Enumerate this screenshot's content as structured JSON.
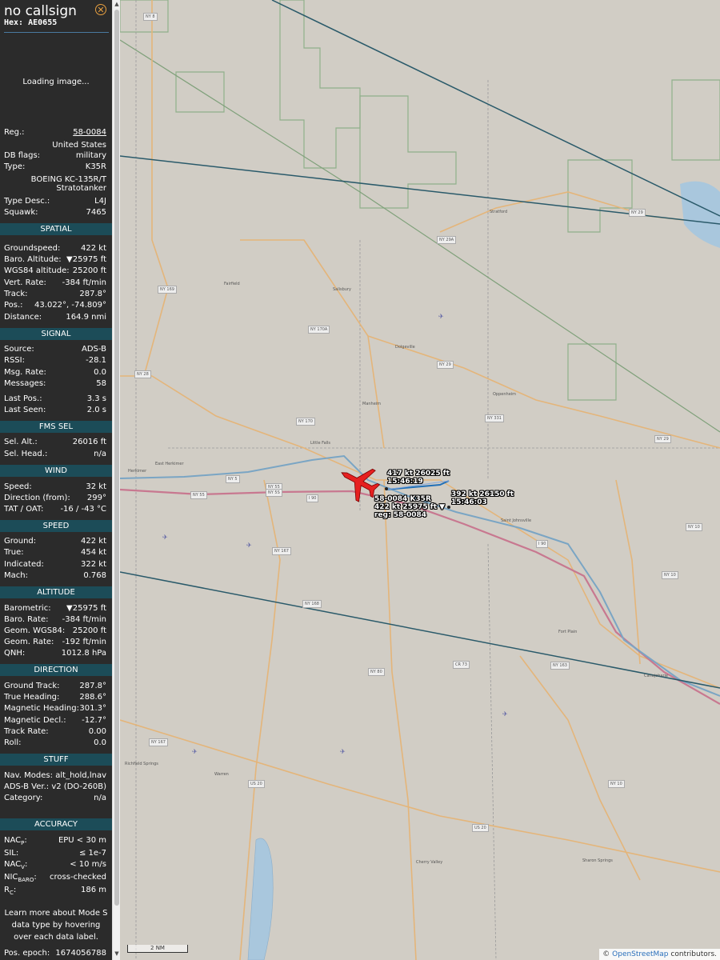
{
  "header": {
    "callsign": "no callsign",
    "hex_label": "Hex:",
    "hex": "AE0655",
    "close_icon": "close-icon",
    "loading_text": "Loading image..."
  },
  "info": {
    "reg_label": "Reg.:",
    "reg": "58-0084",
    "country": "United States",
    "db_flags_label": "DB flags:",
    "db_flags": "military",
    "type_label": "Type:",
    "type": "K35R",
    "type_name_1": "BOEING KC-135R/T",
    "type_name_2": "Stratotanker",
    "type_desc_label": "Type Desc.:",
    "type_desc": "L4J",
    "squawk_label": "Squawk:",
    "squawk": "7465"
  },
  "spatial": {
    "title": "SPATIAL",
    "rows": [
      {
        "k": "Groundspeed:",
        "v": "422 kt"
      },
      {
        "k": "Baro. Altitude:",
        "v": "▼25975 ft"
      },
      {
        "k": "WGS84 altitude:",
        "v": "25200 ft"
      },
      {
        "k": "Vert. Rate:",
        "v": "-384 ft/min"
      },
      {
        "k": "Track:",
        "v": "287.8°"
      },
      {
        "k": "Pos.:",
        "v": "43.022°, -74.809°"
      },
      {
        "k": "Distance:",
        "v": "164.9 nmi"
      }
    ]
  },
  "signal": {
    "title": "SIGNAL",
    "rows": [
      {
        "k": "Source:",
        "v": "ADS-B"
      },
      {
        "k": "RSSI:",
        "v": "-28.1"
      },
      {
        "k": "Msg. Rate:",
        "v": "0.0"
      },
      {
        "k": "Messages:",
        "v": "58"
      }
    ],
    "rows2": [
      {
        "k": "Last Pos.:",
        "v": "3.3 s"
      },
      {
        "k": "Last Seen:",
        "v": "2.0 s"
      }
    ]
  },
  "fms": {
    "title": "FMS SEL",
    "rows": [
      {
        "k": "Sel. Alt.:",
        "v": "26016 ft"
      },
      {
        "k": "Sel. Head.:",
        "v": "n/a"
      }
    ]
  },
  "wind": {
    "title": "WIND",
    "rows": [
      {
        "k": "Speed:",
        "v": "32 kt"
      },
      {
        "k": "Direction (from):",
        "v": "299°"
      },
      {
        "k": "TAT / OAT:",
        "v": "-16 / -43 °C"
      }
    ]
  },
  "speed": {
    "title": "SPEED",
    "rows": [
      {
        "k": "Ground:",
        "v": "422 kt"
      },
      {
        "k": "True:",
        "v": "454 kt"
      },
      {
        "k": "Indicated:",
        "v": "322 kt"
      },
      {
        "k": "Mach:",
        "v": "0.768"
      }
    ]
  },
  "altitude": {
    "title": "ALTITUDE",
    "rows": [
      {
        "k": "Barometric:",
        "v": "▼25975 ft"
      },
      {
        "k": "Baro. Rate:",
        "v": "-384 ft/min"
      },
      {
        "k": "Geom. WGS84:",
        "v": "25200 ft"
      },
      {
        "k": "Geom. Rate:",
        "v": "-192 ft/min"
      },
      {
        "k": "QNH:",
        "v": "1012.8 hPa"
      }
    ]
  },
  "direction": {
    "title": "DIRECTION",
    "rows": [
      {
        "k": "Ground Track:",
        "v": "287.8°"
      },
      {
        "k": "True Heading:",
        "v": "288.6°"
      },
      {
        "k": "Magnetic Heading:",
        "v": "301.3°"
      },
      {
        "k": "Magnetic Decl.:",
        "v": "-12.7°"
      },
      {
        "k": "Track Rate:",
        "v": "0.00"
      },
      {
        "k": "Roll:",
        "v": "0.0"
      }
    ]
  },
  "stuff": {
    "title": "STUFF",
    "rows": [
      {
        "k": "Nav. Modes:",
        "v": "alt_hold,lnav"
      },
      {
        "k": "ADS-B Ver.:",
        "v": "v2 (DO-260B)"
      },
      {
        "k": "Category:",
        "v": "n/a"
      }
    ]
  },
  "accuracy": {
    "title": "ACCURACY",
    "nacp_k": "NAC",
    "nacp_sub": "P",
    "nacp_v": "EPU < 30 m",
    "sil_k": "SIL:",
    "sil_v": "≤ 1e-7",
    "nacv_k": "NAC",
    "nacv_sub": "V",
    "nacv_v": "< 10 m/s",
    "nicbaro_k": "NIC",
    "nicbaro_sub": "BARO",
    "nicbaro_v": "cross-checked",
    "rc_k": "R",
    "rc_sub": "C",
    "rc_v": "186 m"
  },
  "footer": {
    "learn_more": "Learn more about Mode S data type by hovering over each data label.",
    "pos_epoch_label": "Pos. epoch:",
    "pos_epoch": "1674056788"
  },
  "map": {
    "scale": "2 NM",
    "attribution_prefix": "©",
    "attribution_link": "OpenStreetMap",
    "attribution_suffix": "contributors.",
    "aircraft_label_1": "58-0084 K35R",
    "aircraft_label_2": "422 kt 25975 ft ▼",
    "aircraft_label_3": "reg: 58-0084",
    "track_label_a_1": "417 kt  26025 ft",
    "track_label_a_2": "15:46:19",
    "track_label_b_1": "392 kt  26150 ft",
    "track_label_b_2": "15:46:03",
    "aircraft_icon": "airplane-icon",
    "places": {
      "herkimer": "Herkimer",
      "east_herkimer": "East Herkimer",
      "little_falls": "Little Falls",
      "fairfield": "Fairfield",
      "salisbury": "Salisbury",
      "dolgeville": "Dolgeville",
      "manheim": "Manheim",
      "oppenheim": "Oppenheim",
      "stratford": "Stratford",
      "st_johnsville": "Saint Johnsville",
      "fort_plain": "Fort Plain",
      "canajoharie": "Canajoharie",
      "cherry_valley": "Cherry Valley",
      "sharon_springs": "Sharon Springs",
      "richfield_springs": "Richfield Springs",
      "warren": "Warren"
    },
    "roads": {
      "ny8": "NY 8",
      "ny29": "NY 29",
      "ny29a": "NY 29A",
      "ny169": "NY 169",
      "ny170a": "NY 170A",
      "ny170": "NY 170",
      "ny28": "NY 28",
      "ny331": "NY 331",
      "ny5": "NY 5",
      "ny5s": "NY 5S",
      "ny55": "NY 55",
      "i90": "I 90",
      "ny167": "NY 167",
      "ny168": "NY 168",
      "ny80": "NY 80",
      "cr73": "CR 73",
      "ny163": "NY 163",
      "ny10": "NY 10",
      "us20": "US 20"
    }
  }
}
